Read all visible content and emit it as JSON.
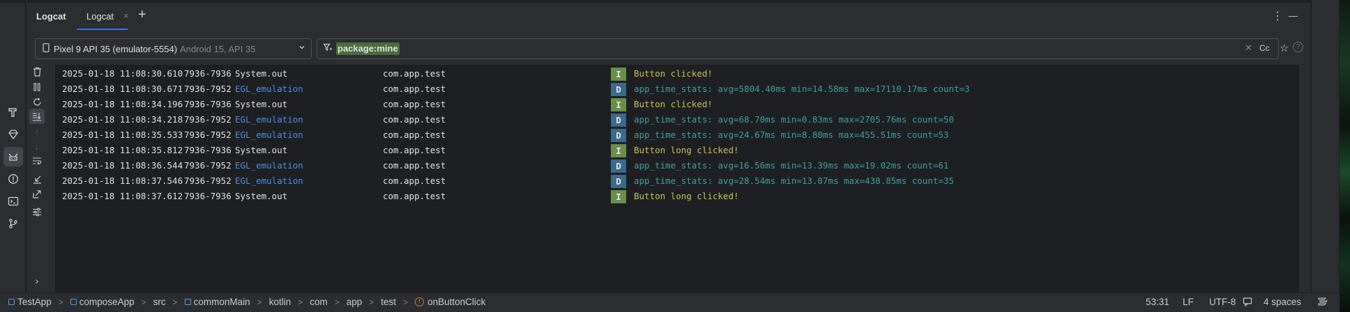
{
  "panel": {
    "title": "Logcat",
    "tabs": [
      {
        "label": "Logcat",
        "close": "×"
      }
    ],
    "add_tab": "+",
    "more": "⋮",
    "minimize": "—"
  },
  "device": {
    "name": "Pixel 9 API 35 (emulator-5554)",
    "info": "Android 15, API 35"
  },
  "filter": {
    "value": "package:mine",
    "case_label": "Cc"
  },
  "log": {
    "rows": [
      {
        "timestamp": "2025-01-18 11:08:30.610",
        "pid": "7936-7936",
        "tag": "System.out",
        "package": "com.app.test",
        "level": "I",
        "message": "Button clicked!"
      },
      {
        "timestamp": "2025-01-18 11:08:30.671",
        "pid": "7936-7952",
        "tag": "EGL_emulation",
        "package": "com.app.test",
        "level": "D",
        "message": "app_time_stats: avg=5804.40ms min=14.58ms max=17110.17ms count=3"
      },
      {
        "timestamp": "2025-01-18 11:08:34.196",
        "pid": "7936-7936",
        "tag": "System.out",
        "package": "com.app.test",
        "level": "I",
        "message": "Button clicked!"
      },
      {
        "timestamp": "2025-01-18 11:08:34.218",
        "pid": "7936-7952",
        "tag": "EGL_emulation",
        "package": "com.app.test",
        "level": "D",
        "message": "app_time_stats: avg=68.70ms min=0.83ms max=2705.76ms count=50"
      },
      {
        "timestamp": "2025-01-18 11:08:35.533",
        "pid": "7936-7952",
        "tag": "EGL_emulation",
        "package": "com.app.test",
        "level": "D",
        "message": "app_time_stats: avg=24.67ms min=8.80ms max=455.51ms count=53"
      },
      {
        "timestamp": "2025-01-18 11:08:35.812",
        "pid": "7936-7936",
        "tag": "System.out",
        "package": "com.app.test",
        "level": "I",
        "message": "Button long clicked!"
      },
      {
        "timestamp": "2025-01-18 11:08:36.544",
        "pid": "7936-7952",
        "tag": "EGL_emulation",
        "package": "com.app.test",
        "level": "D",
        "message": "app_time_stats: avg=16.56ms min=13.39ms max=19.02ms count=61"
      },
      {
        "timestamp": "2025-01-18 11:08:37.546",
        "pid": "7936-7952",
        "tag": "EGL_emulation",
        "package": "com.app.test",
        "level": "D",
        "message": "app_time_stats: avg=28.54ms min=13.07ms max=438.85ms count=35"
      },
      {
        "timestamp": "2025-01-18 11:08:37.612",
        "pid": "7936-7936",
        "tag": "System.out",
        "package": "com.app.test",
        "level": "I",
        "message": "Button long clicked!"
      }
    ]
  },
  "toolbar_icons": [
    "trash-icon",
    "pause-icon",
    "restart-icon",
    "scroll-to-end-icon",
    "up-arrow-icon",
    "down-arrow-icon",
    "soft-wrap-icon",
    "import-icon",
    "export-icon",
    "settings-icon",
    "expand-icon"
  ],
  "stripe_icons": [
    "build-icon",
    "gem-icon",
    "logcat-icon",
    "problems-icon",
    "terminal-icon",
    "git-icon"
  ],
  "breadcrumb": {
    "items": [
      {
        "label": "TestApp",
        "kind": "module"
      },
      {
        "label": "composeApp",
        "kind": "module"
      },
      {
        "label": "src",
        "kind": "folder"
      },
      {
        "label": "commonMain",
        "kind": "module"
      },
      {
        "label": "kotlin",
        "kind": "folder"
      },
      {
        "label": "com",
        "kind": "folder"
      },
      {
        "label": "app",
        "kind": "folder"
      },
      {
        "label": "test",
        "kind": "folder"
      },
      {
        "label": "onButtonClick",
        "kind": "function"
      }
    ],
    "separator": ">"
  },
  "status": {
    "position": "53:31",
    "line_ending": "LF",
    "encoding": "UTF-8",
    "indent": "4 spaces"
  },
  "colors": {
    "background": "#1e1f22",
    "panel": "#2b2d30",
    "tag_link": "#4e8ee6",
    "info_level": "#6a8f4b",
    "debug_level": "#3a6a8c",
    "info_message": "#c9c34a",
    "debug_message": "#3fa0a0",
    "accent": "#3574f0"
  }
}
